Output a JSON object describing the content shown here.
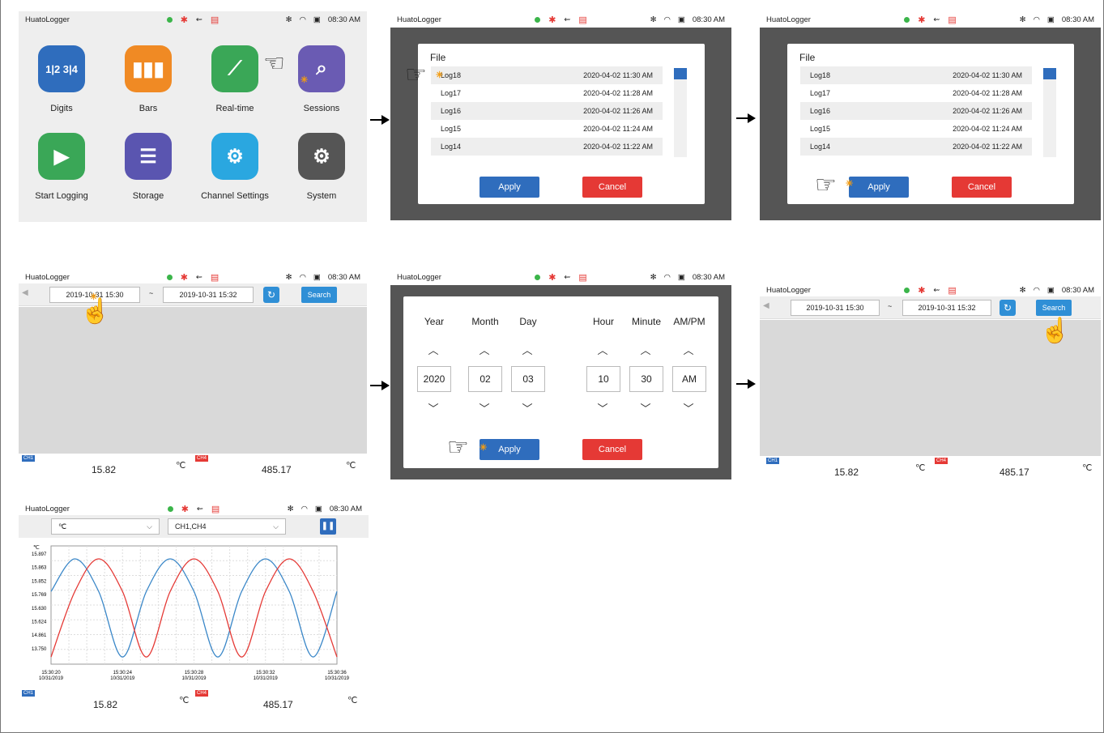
{
  "status": {
    "app_name": "HuatoLogger",
    "time": "08:30 AM"
  },
  "home": {
    "tiles": [
      {
        "label": "Digits",
        "icon": "digits-icon",
        "color": "#2f6dbd",
        "glyph": "1|2 3|4"
      },
      {
        "label": "Bars",
        "icon": "bars-icon",
        "color": "#f08a24",
        "glyph": "▮▮▮"
      },
      {
        "label": "Real-time",
        "icon": "realtime-icon",
        "color": "#3aa757",
        "glyph": "⟋"
      },
      {
        "label": "Sessions",
        "icon": "sessions-icon",
        "color": "#6a5bb3",
        "glyph": "⌕"
      },
      {
        "label": "Start Logging",
        "icon": "play-icon",
        "color": "#3aa757",
        "glyph": "▶"
      },
      {
        "label": "Storage",
        "icon": "storage-icon",
        "color": "#5a55b0",
        "glyph": "☰"
      },
      {
        "label": "Channel Settings",
        "icon": "channel-settings-icon",
        "color": "#2aa7e0",
        "glyph": "⚙"
      },
      {
        "label": "System",
        "icon": "system-icon",
        "color": "#555555",
        "glyph": "⚙"
      }
    ]
  },
  "file_dialog": {
    "title": "File",
    "files": [
      {
        "name": "Log18",
        "date": "2020-04-02  11:30 AM"
      },
      {
        "name": "Log17",
        "date": "2020-04-02  11:28 AM"
      },
      {
        "name": "Log16",
        "date": "2020-04-02  11:26 AM"
      },
      {
        "name": "Log15",
        "date": "2020-04-02  11:24 AM"
      },
      {
        "name": "Log14",
        "date": "2020-04-02  11:22 AM"
      }
    ],
    "apply": "Apply",
    "cancel": "Cancel"
  },
  "search": {
    "start": "2019-10-31  15:30",
    "tilde": "~",
    "end": "2019-10-31  15:32",
    "button": "Search",
    "ch1_tag": "CH1",
    "ch1_value": "15.82",
    "ch4_tag": "CH4",
    "ch4_value": "485.17",
    "unit": "℃"
  },
  "picker": {
    "headers": [
      "Year",
      "Month",
      "Day",
      "Hour",
      "Minute",
      "AM/PM"
    ],
    "values": [
      "2020",
      "02",
      "03",
      "10",
      "30",
      "AM"
    ],
    "apply": "Apply",
    "cancel": "Cancel"
  },
  "chart_screen": {
    "unit_select": "℃",
    "channel_select": "CH1,CH4",
    "ch1_tag": "CH1",
    "ch1_value": "15.82",
    "ch4_tag": "CH4",
    "ch4_value": "485.17",
    "unit": "℃"
  },
  "chart_data": {
    "type": "line",
    "ylabel": "℃",
    "y_ticks": [
      "15.897",
      "15.863",
      "15.852",
      "15.769",
      "15.630",
      "15.624",
      "14.861",
      "13.750"
    ],
    "x_ticks": [
      {
        "time": "15:30:20",
        "date": "10/31/2019"
      },
      {
        "time": "15:30:24",
        "date": "10/31/2019"
      },
      {
        "time": "15:30:28",
        "date": "10/31/2019"
      },
      {
        "time": "15:30:32",
        "date": "10/31/2019"
      },
      {
        "time": "15:30:36",
        "date": "10/31/2019"
      }
    ],
    "series": [
      {
        "color": "#3a87c8",
        "values": [
          15.2,
          15.897,
          15.2,
          13.8,
          15.2,
          15.897,
          15.2,
          13.8,
          15.2,
          15.897,
          15.2,
          13.8,
          15.2
        ]
      },
      {
        "color": "#e53935",
        "values": [
          13.8,
          15.2,
          15.897,
          15.2,
          13.8,
          15.2,
          15.897,
          15.2,
          13.8,
          15.2,
          15.897,
          15.2,
          13.8
        ]
      }
    ],
    "grid": true
  }
}
